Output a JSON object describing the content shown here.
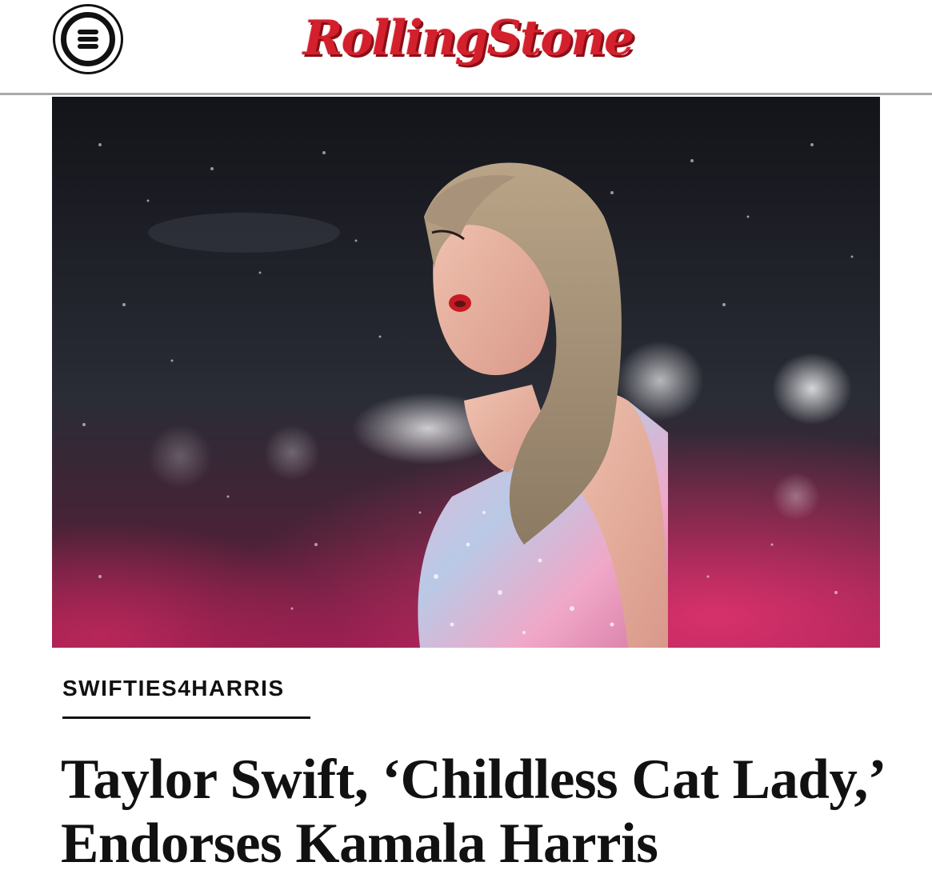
{
  "header": {
    "logo_text": "RollingStone",
    "brand_color": "#d3202c",
    "menu_icon": "hamburger-menu-icon"
  },
  "hero_image": {
    "alt": "Taylor Swift performing on stage in the rain wearing a sparkly bodysuit"
  },
  "article": {
    "category": "SWIFTIES4HARRIS",
    "headline": "Taylor Swift, ‘Childless Cat Lady,’ Endorses Kamala Harris"
  }
}
